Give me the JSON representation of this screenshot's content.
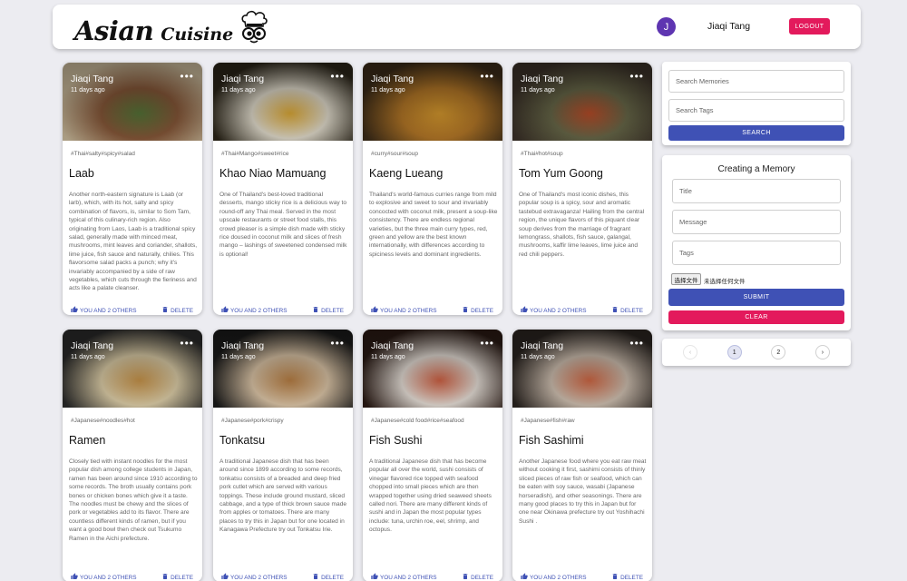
{
  "header": {
    "brand_word1": "Asian",
    "brand_word2": "Cuisine",
    "user_initial": "J",
    "user_name": "Jiaqi Tang",
    "logout_label": "LOGOUT"
  },
  "cards": [
    {
      "author": "Jiaqi Tang",
      "time": "11 days ago",
      "tags": "#Thai#salty#spicy#salad",
      "title": "Laab",
      "body": "Another north-eastern signature is Laab (or larb), which, with its hot, salty and spicy combination of flavors, is, similar to Som Tam, typical of this culinary-rich region. Also originating from Laos, Laab is a traditional spicy salad, generally made with minced meat, mushrooms, mint leaves and coriander, shallots, lime juice, fish sauce and naturally, chilies. This flavorsome salad packs a punch; why it's invariably accompanied by a side of raw vegetables, which cuts through the fieriness and acts like a palate cleanser.",
      "like_label": "YOU AND 2 OTHERS",
      "delete_label": "DELETE",
      "colors": [
        "#c9b99a",
        "#5a7a3a",
        "#8a5a3a"
      ]
    },
    {
      "author": "Jiaqi Tang",
      "time": "11 days ago",
      "tags": "#Thai#Mango#sweet#rice",
      "title": "Khao Niao Mamuang",
      "body": "One of Thailand's best-loved traditional desserts, mango sticky rice is a delicious way to round-off any Thai meal. Served in the most upscale restaurants or street food stalls, this crowd pleaser is a simple dish made with sticky rice doused in coconut milk and slices of fresh mango – lashings of sweetened condensed milk is optional!",
      "like_label": "YOU AND 2 OTHERS",
      "delete_label": "DELETE",
      "colors": [
        "#2a2418",
        "#e9b33a",
        "#e8e2d2"
      ]
    },
    {
      "author": "Jiaqi Tang",
      "time": "11 days ago",
      "tags": "#curry#sour#soup",
      "title": "Kaeng Lueang",
      "body": "Thailand's world-famous curries range from mild to explosive and sweet to sour and invariably concocted with coconut milk, present a soup-like consistency. There are endless regional varieties, but the three main curry types, red, green and yellow are the best known internationally, with differences according to spiciness levels and dominant ingredients.",
      "like_label": "YOU AND 2 OTHERS",
      "delete_label": "DELETE",
      "colors": [
        "#3a2a18",
        "#e0a030",
        "#b87a28"
      ]
    },
    {
      "author": "Jiaqi Tang",
      "time": "11 days ago",
      "tags": "#Thai#hot#soup",
      "title": "Tom Yum Goong",
      "body": "One of Thailand's most iconic dishes, this popular soup is a spicy, sour and aromatic tastebud extravaganza! Hailing from the central region, the unique flavors of this piquant clear soup derives from the marriage of fragrant lemongrass, shallots, fish sauce, galangal, mushrooms, kaffir lime leaves, lime juice and red chili peppers.",
      "like_label": "YOU AND 2 OTHERS",
      "delete_label": "DELETE",
      "colors": [
        "#3a3028",
        "#c0502a",
        "#6a6a4a"
      ]
    },
    {
      "author": "Jiaqi Tang",
      "time": "11 days ago",
      "tags": "#Japanese#noodles#hot",
      "title": "Ramen",
      "body": "Closely tied with instant noodles for the most popular dish among college students in Japan, ramen has been around since 1910 according to some records. The broth usually contains pork bones or chicken bones which give it a taste. The noodles must be chewy and the slices of pork or vegetables add to its flavor. There are countless different kinds of ramen, but if you want a good bowl then check out Tsukumo Ramen in the Aichi prefecture.",
      "like_label": "YOU AND 2 OTHERS",
      "delete_label": "DELETE",
      "colors": [
        "#2a2a2a",
        "#d8a050",
        "#e8d8b0"
      ]
    },
    {
      "author": "Jiaqi Tang",
      "time": "11 days ago",
      "tags": "#Japanese#pork#crispy",
      "title": "Tonkatsu",
      "body": "A traditional Japanese dish that has been around since 1899 according to some records, tonkatsu consists of a breaded and deep fried pork cutlet which are served with various toppings. These include ground mustard, sliced cabbage, and a type of thick brown sauce made from apples or tomatoes. There are many places to try this in Japan but for one located in Kanagawa Prefecture try out Tonkatsu Irie.",
      "like_label": "YOU AND 2 OTHERS",
      "delete_label": "DELETE",
      "colors": [
        "#1a1a1a",
        "#c88a4a",
        "#e8d0b0"
      ]
    },
    {
      "author": "Jiaqi Tang",
      "time": "11 days ago",
      "tags": "#Japanese#cold food#rice#seafood",
      "title": "Fish Sushi",
      "body": "A traditional Japanese dish that has become popular all over the world, sushi consists of vinegar flavored rice topped with seafood chopped into small pieces which are then wrapped together using dried seaweed sheets called nori. There are many different kinds of sushi and in Japan the most popular types include: tuna, urchin roe, eel, shrimp, and octopus.",
      "like_label": "YOU AND 2 OTHERS",
      "delete_label": "DELETE",
      "colors": [
        "#2a1a14",
        "#e06a4a",
        "#f0e8e0"
      ]
    },
    {
      "author": "Jiaqi Tang",
      "time": "11 days ago",
      "tags": "#Japanese#fish#raw",
      "title": "Fish Sashimi",
      "body": "Another Japanese food where you eat raw meat without cooking it first, sashimi consists of thinly sliced pieces of raw fish or seafood, which can be eaten with soy sauce, wasabi (Japanese horseradish), and other seasonings. There are many good places to try this in Japan but for one near Okinawa prefecture try out Yoshihachi Sushi .",
      "like_label": "YOU AND 2 OTHERS",
      "delete_label": "DELETE",
      "colors": [
        "#2a2420",
        "#e0704a",
        "#d8c8b8"
      ]
    }
  ],
  "search": {
    "memories_placeholder": "Search Memories",
    "tags_placeholder": "Search Tags",
    "button_label": "SEARCH"
  },
  "form": {
    "title": "Creating a Memory",
    "title_placeholder": "Title",
    "message_placeholder": "Message",
    "tags_placeholder": "Tags",
    "file_button": "选择文件",
    "file_status": "未选择任何文件",
    "submit_label": "SUBMIT",
    "clear_label": "CLEAR"
  },
  "pagination": {
    "prev": "‹",
    "pages": [
      "1",
      "2"
    ],
    "next": "›"
  }
}
